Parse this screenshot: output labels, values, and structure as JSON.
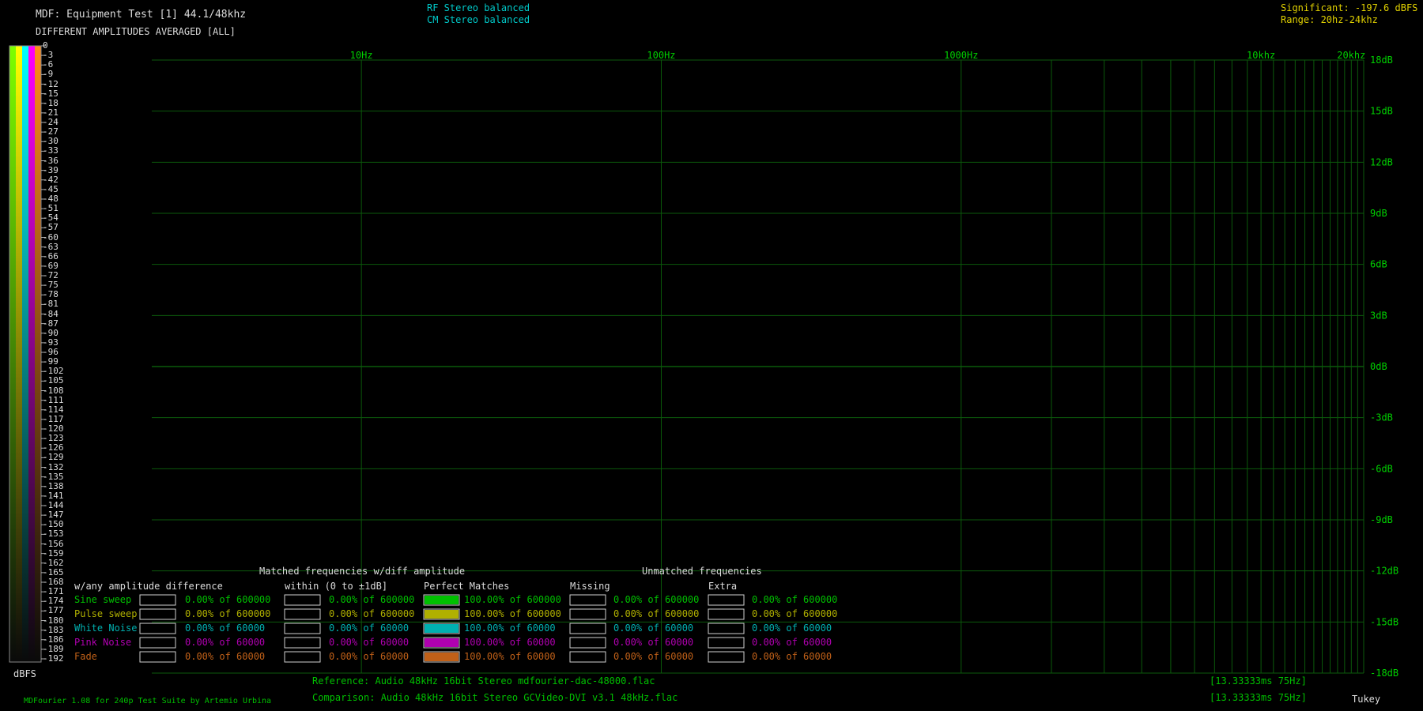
{
  "header": {
    "title": "MDF: Equipment Test [1] 44.1/48khz",
    "subtitle": "DIFFERENT AMPLITUDES AVERAGED [ALL]",
    "legend_line1": "RF Stereo balanced",
    "legend_line2": "CM Stereo balanced",
    "significant": "Significant: -197.6 dBFS",
    "range": "Range: 20hz-24khz"
  },
  "colorbar": {
    "unit": "dBFS",
    "ticks": [
      "0",
      "-3",
      "-6",
      "-9",
      "-12",
      "-15",
      "-18",
      "-21",
      "-24",
      "-27",
      "-30",
      "-33",
      "-36",
      "-39",
      "-42",
      "-45",
      "-48",
      "-51",
      "-54",
      "-57",
      "-60",
      "-63",
      "-66",
      "-69",
      "-72",
      "-75",
      "-78",
      "-81",
      "-84",
      "-87",
      "-90",
      "-93",
      "-96",
      "-99",
      "-102",
      "-105",
      "-108",
      "-111",
      "-114",
      "-117",
      "-120",
      "-123",
      "-126",
      "-129",
      "-132",
      "-135",
      "-138",
      "-141",
      "-144",
      "-147",
      "-150",
      "-153",
      "-156",
      "-159",
      "-162",
      "-165",
      "-168",
      "-171",
      "-174",
      "-177",
      "-180",
      "-183",
      "-186",
      "-189",
      "-192"
    ],
    "stripes": [
      "#7cff00",
      "#ffff00",
      "#00ffff",
      "#ff00ff",
      "#ff8c1a"
    ]
  },
  "chart_data": {
    "type": "scatter",
    "x_scale": "log",
    "xlim": [
      2,
      22000
    ],
    "ylim": [
      -18,
      18
    ],
    "x_ticks": [
      {
        "value": 10,
        "label": "10Hz"
      },
      {
        "value": 100,
        "label": "100Hz"
      },
      {
        "value": 1000,
        "label": "1000Hz"
      },
      {
        "value": 10000,
        "label": "10khz"
      },
      {
        "value": 20000,
        "label": "20khz"
      }
    ],
    "x_minor": [
      2000,
      3000,
      4000,
      5000,
      6000,
      7000,
      8000,
      9000,
      11000,
      12000,
      13000,
      14000,
      15000,
      16000,
      17000,
      18000,
      19000,
      21000
    ],
    "y_ticks": [
      {
        "value": 18,
        "label": "18dB"
      },
      {
        "value": 15,
        "label": "15dB"
      },
      {
        "value": 12,
        "label": "12dB"
      },
      {
        "value": 9,
        "label": "9dB"
      },
      {
        "value": 6,
        "label": "6dB"
      },
      {
        "value": 3,
        "label": "3dB"
      },
      {
        "value": 0,
        "label": "0dB"
      },
      {
        "value": -3,
        "label": "-3dB"
      },
      {
        "value": -6,
        "label": "-6dB"
      },
      {
        "value": -9,
        "label": "-9dB"
      },
      {
        "value": -12,
        "label": "-12dB"
      },
      {
        "value": -15,
        "label": "-15dB"
      },
      {
        "value": -18,
        "label": "-18dB"
      }
    ],
    "series": []
  },
  "stats": {
    "group_matched": "Matched frequencies w/diff amplitude",
    "group_unmatched": "Unmatched frequencies",
    "col_any": "w/any amplitude difference",
    "col_within": "within (0 to ±1dB]",
    "col_perfect": "Perfect Matches",
    "col_missing": "Missing",
    "col_extra": "Extra",
    "rows": [
      {
        "name": "Sine sweep",
        "color": "#00c000",
        "any": "0.00% of 600000",
        "within": "0.00% of 600000",
        "perfect": "100.00% of 600000",
        "missing": "0.00% of 600000",
        "extra": "0.00% of 600000",
        "fill": 1.0
      },
      {
        "name": "Pulse sweep",
        "color": "#b0b000",
        "any": "0.00% of 600000",
        "within": "0.00% of 600000",
        "perfect": "100.00% of 600000",
        "missing": "0.00% of 600000",
        "extra": "0.00% of 600000",
        "fill": 1.0
      },
      {
        "name": "White Noise",
        "color": "#00b0b0",
        "any": "0.00% of 60000",
        "within": "0.00% of 60000",
        "perfect": "100.00% of 60000",
        "missing": "0.00% of 60000",
        "extra": "0.00% of 60000",
        "fill": 1.0
      },
      {
        "name": "Pink Noise",
        "color": "#b000b0",
        "any": "0.00% of 60000",
        "within": "0.00% of 60000",
        "perfect": "100.00% of 60000",
        "missing": "0.00% of 60000",
        "extra": "0.00% of 60000",
        "fill": 1.0
      },
      {
        "name": "Fade",
        "color": "#c06018",
        "any": "0.00% of 60000",
        "within": "0.00% of 60000",
        "perfect": "100.00% of 60000",
        "missing": "0.00% of 60000",
        "extra": "0.00% of 60000",
        "fill": 1.0
      }
    ]
  },
  "footer": {
    "credit": "MDFourier 1.08 for 240p Test Suite by Artemio Urbina",
    "reference": "Reference:  Audio   48kHz 16bit Stereo mdfourier-dac-48000.flac",
    "comparison": "Comparison: Audio   48kHz 16bit Stereo GCVideo-DVI v3.1 48kHz.flac",
    "ref_timing": "[13.33333ms 75Hz]",
    "cmp_timing": "[13.33333ms 75Hz]",
    "window": "Tukey"
  },
  "colors": {
    "grid": "#0b5a0b",
    "axis_text": "#00d000",
    "legend_text": "#00c8c8",
    "significant_text": "#e0d000"
  }
}
